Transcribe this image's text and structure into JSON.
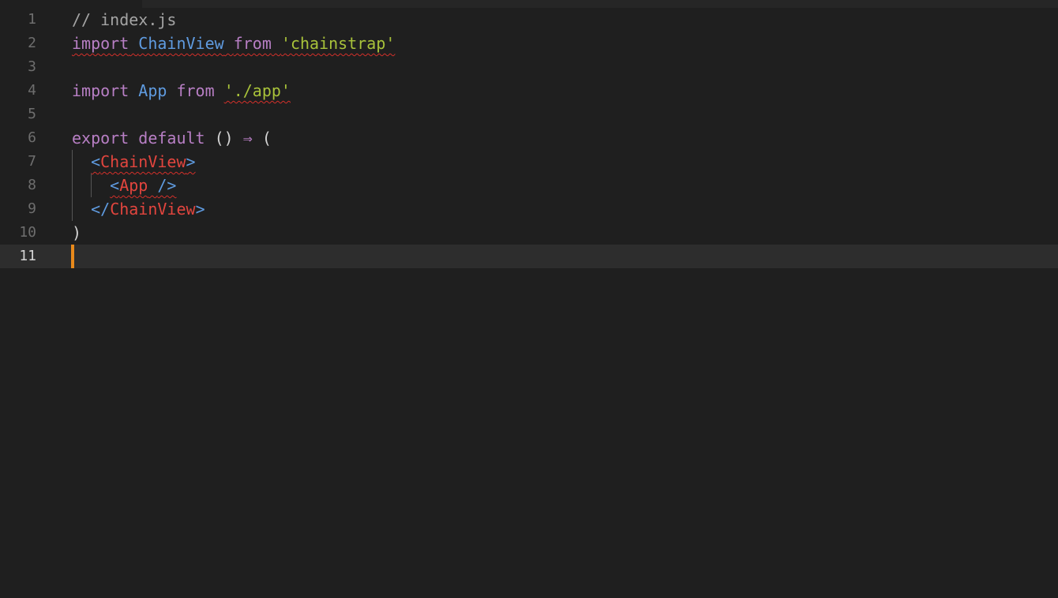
{
  "editor": {
    "lines": [
      {
        "num": "1",
        "parts": [
          "// index.js"
        ]
      },
      {
        "num": "2",
        "parts": [
          "import",
          " ",
          "ChainView",
          " ",
          "from",
          " ",
          "'chainstrap'"
        ]
      },
      {
        "num": "3",
        "parts": []
      },
      {
        "num": "4",
        "parts": [
          "import",
          " ",
          "App",
          " ",
          "from",
          " ",
          "'./app'"
        ]
      },
      {
        "num": "5",
        "parts": []
      },
      {
        "num": "6",
        "parts": [
          "export",
          " ",
          "default",
          " ",
          "()",
          " ",
          "⇒",
          " ",
          "("
        ]
      },
      {
        "num": "7",
        "parts": [
          "  ",
          "<",
          "ChainView",
          ">"
        ]
      },
      {
        "num": "8",
        "parts": [
          "    ",
          "<",
          "App",
          " ",
          "/>"
        ]
      },
      {
        "num": "9",
        "parts": [
          "  ",
          "</",
          "ChainView",
          ">"
        ]
      },
      {
        "num": "10",
        "parts": [
          ")"
        ]
      },
      {
        "num": "11",
        "parts": []
      }
    ],
    "current_line": "11"
  },
  "colors": {
    "background": "#1f1f1f",
    "current_line": "#2d2d2d",
    "keyword": "#b87fc5",
    "identifier": "#5f9be0",
    "string": "#a8c23a",
    "jsx_tag": "#e2453e",
    "comment": "#a4a4a4",
    "cursor": "#e8891b",
    "error_squiggle": "#d4302a"
  }
}
